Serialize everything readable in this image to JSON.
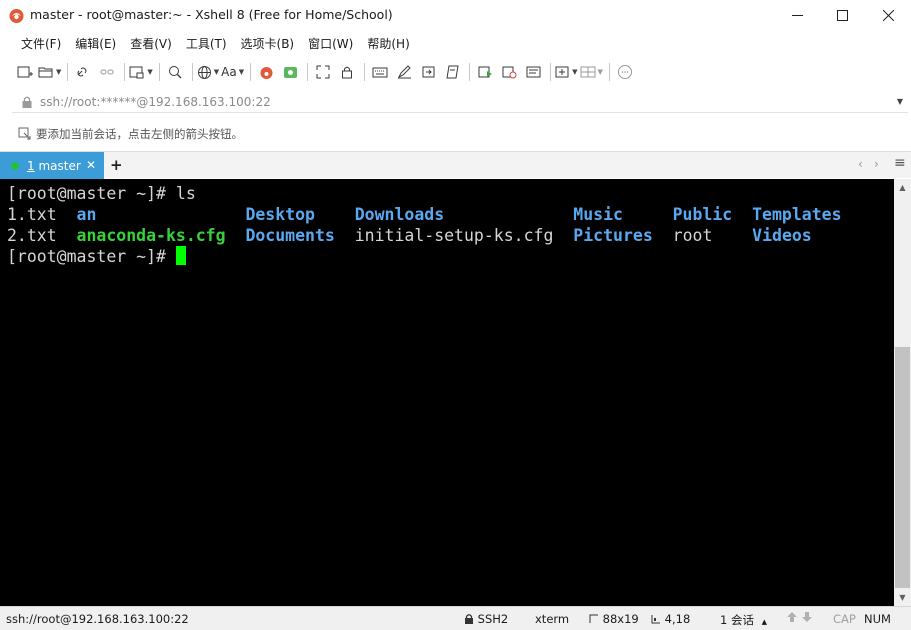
{
  "window": {
    "title": "master - root@master:~ - Xshell 8 (Free for Home/School)",
    "controls": {
      "minimize": "—",
      "maximize": "☐",
      "close": "✕"
    }
  },
  "menu": [
    "文件(F)",
    "编辑(E)",
    "查看(V)",
    "工具(T)",
    "选项卡(B)",
    "窗口(W)",
    "帮助(H)"
  ],
  "toolbar": {
    "font_button_label": "Aa"
  },
  "address": {
    "value": "ssh://root:******@192.168.163.100:22"
  },
  "hint": {
    "text": "要添加当前会话，点击左侧的箭头按钮。"
  },
  "tabs": {
    "active": {
      "number": "1",
      "name": "master",
      "close": "✕"
    },
    "add": "+",
    "nav_left": "‹",
    "nav_right": "›",
    "menu": "≡"
  },
  "terminal": {
    "prompt1": "[root@master ~]# ",
    "command1": "ls",
    "ls_rows": [
      [
        {
          "text": "1.txt",
          "type": "plain"
        },
        {
          "text": "an",
          "type": "dir"
        },
        {
          "text": "Desktop",
          "type": "dir"
        },
        {
          "text": "Downloads",
          "type": "dir"
        },
        {
          "text": "Music",
          "type": "dir"
        },
        {
          "text": "Public",
          "type": "dir"
        },
        {
          "text": "Templates",
          "type": "dir"
        }
      ],
      [
        {
          "text": "2.txt",
          "type": "plain"
        },
        {
          "text": "anaconda-ks.cfg",
          "type": "green"
        },
        {
          "text": "Documents",
          "type": "dir"
        },
        {
          "text": "initial-setup-ks.cfg",
          "type": "plain"
        },
        {
          "text": "Pictures",
          "type": "dir"
        },
        {
          "text": "root",
          "type": "plain"
        },
        {
          "text": "Videos",
          "type": "dir"
        }
      ]
    ],
    "prompt2": "[root@master ~]# ",
    "colors": {
      "background": "#000000",
      "text": "#d6d6d6",
      "dir": "#5aa9f0",
      "green": "#37d13a",
      "cursor": "#00ff00"
    }
  },
  "status": {
    "connection": "ssh://root@192.168.163.100:22",
    "protocol": "SSH2",
    "terminal_type": "xterm",
    "size": "88x19",
    "cursor_pos": "4,18",
    "sessions": "1 会话",
    "caps": "CAP",
    "num": "NUM"
  },
  "colors": {
    "tab_active": "#3c9cd8",
    "tab_dot": "#20c040",
    "app_icon": "#e05a3a"
  }
}
